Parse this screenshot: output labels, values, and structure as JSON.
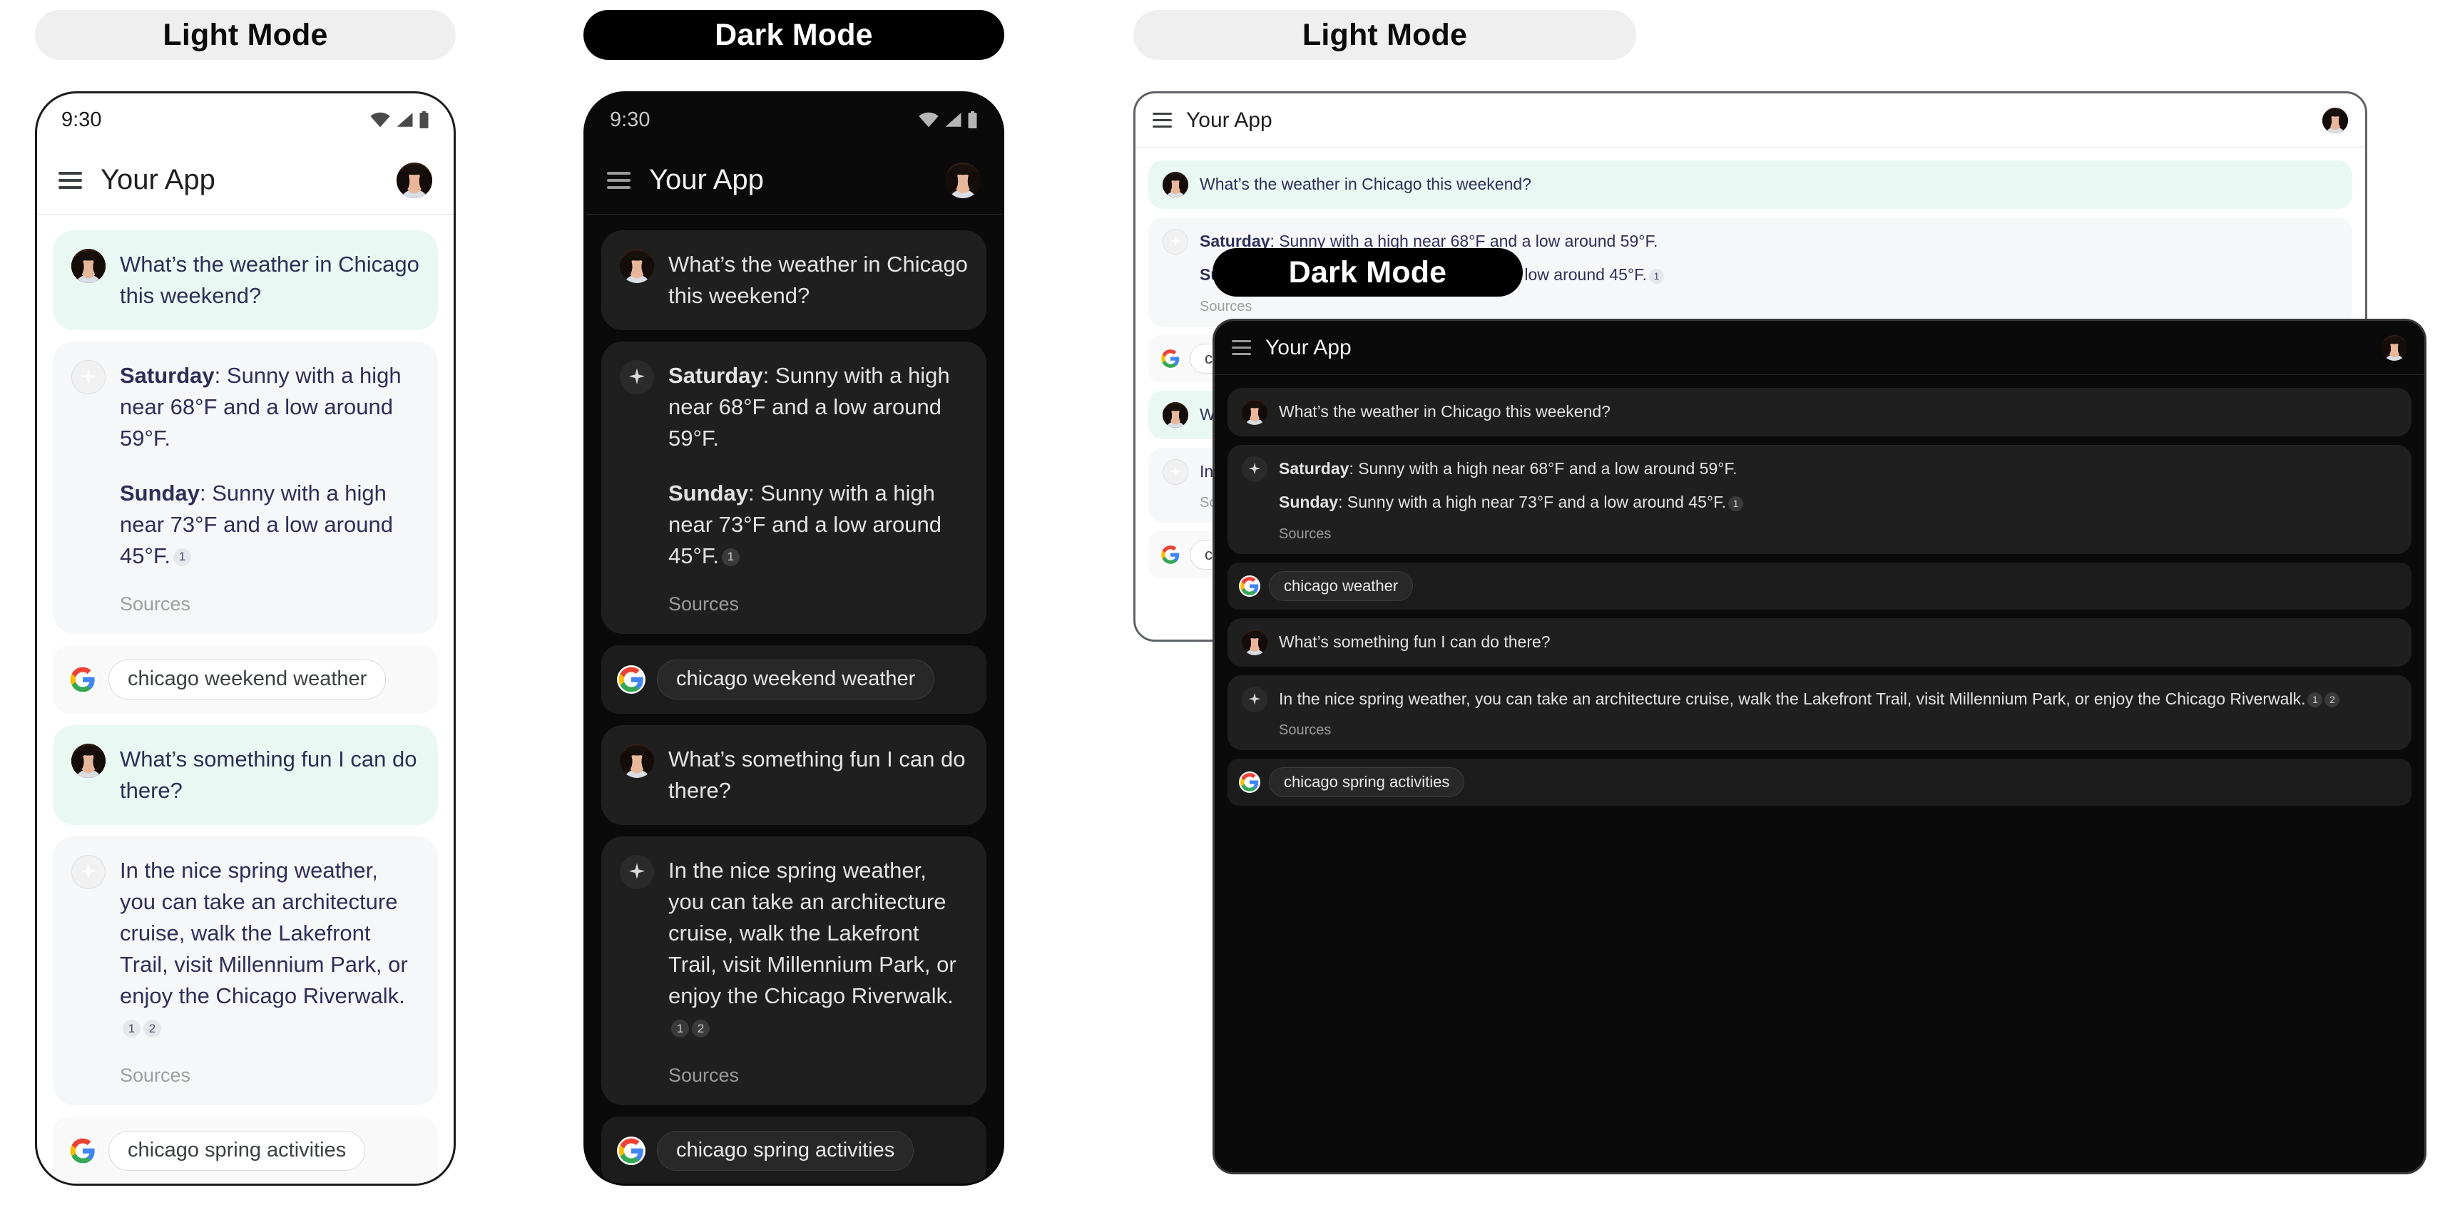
{
  "panels": {
    "phone_light": {
      "mode_label": "Light Mode",
      "theme": "light"
    },
    "phone_dark": {
      "mode_label": "Dark Mode",
      "theme": "dark"
    },
    "desktop_light": {
      "mode_label": "Light Mode",
      "theme": "light"
    },
    "desktop_dark": {
      "mode_label": "Dark Mode",
      "theme": "dark"
    }
  },
  "statusbar": {
    "time": "9:30",
    "icons": [
      "wifi-icon",
      "cell-signal-icon",
      "battery-icon"
    ]
  },
  "appbar": {
    "menu_icon": "hamburger-menu-icon",
    "title": "Your App",
    "avatar": "user-avatar"
  },
  "conversation": {
    "turn1": {
      "user_message": "What’s the weather in Chicago this weekend?",
      "assistant": {
        "line1_label": "Saturday",
        "line1_text": ": Sunny with a high near 68°F and a low around 59°F.",
        "line2_label": "Sunday",
        "line2_text": ": Sunny with a high near 73°F and a low around 45°F.",
        "line2_citations": [
          "1"
        ],
        "sources_label": "Sources"
      },
      "search_chip": "chicago weekend weather",
      "search_chip_short": "chicago weather"
    },
    "turn2": {
      "user_message": "What’s something fun I can do there?",
      "assistant": {
        "text": "In the nice spring weather, you can take an architecture cruise, walk the Lakefront Trail, visit Millennium Park, or enjoy the Chicago Riverwalk.",
        "citations": [
          "1",
          "2"
        ],
        "sources_label": "Sources"
      },
      "search_chip": "chicago spring activities"
    }
  },
  "colors": {
    "user_bubble_light": "#e9f8f2",
    "user_bubble_dark": "#1f1f1f",
    "ai_bubble_light": "#f6f7f9",
    "ai_bubble_dark": "#1f1f1f",
    "text_light": "#2e2f57",
    "text_dark": "#e3e3e3",
    "sources_light": "#9e9e9e",
    "sources_dark": "#9a9a9a",
    "pill_light_bg": "#efefef",
    "pill_dark_bg": "#000000",
    "google_blue": "#4285f4",
    "google_red": "#ea4335",
    "google_yellow": "#fbbc05",
    "google_green": "#34a853"
  },
  "icons": {
    "assistant": "sparkle-icon",
    "google": "google-g-icon"
  }
}
